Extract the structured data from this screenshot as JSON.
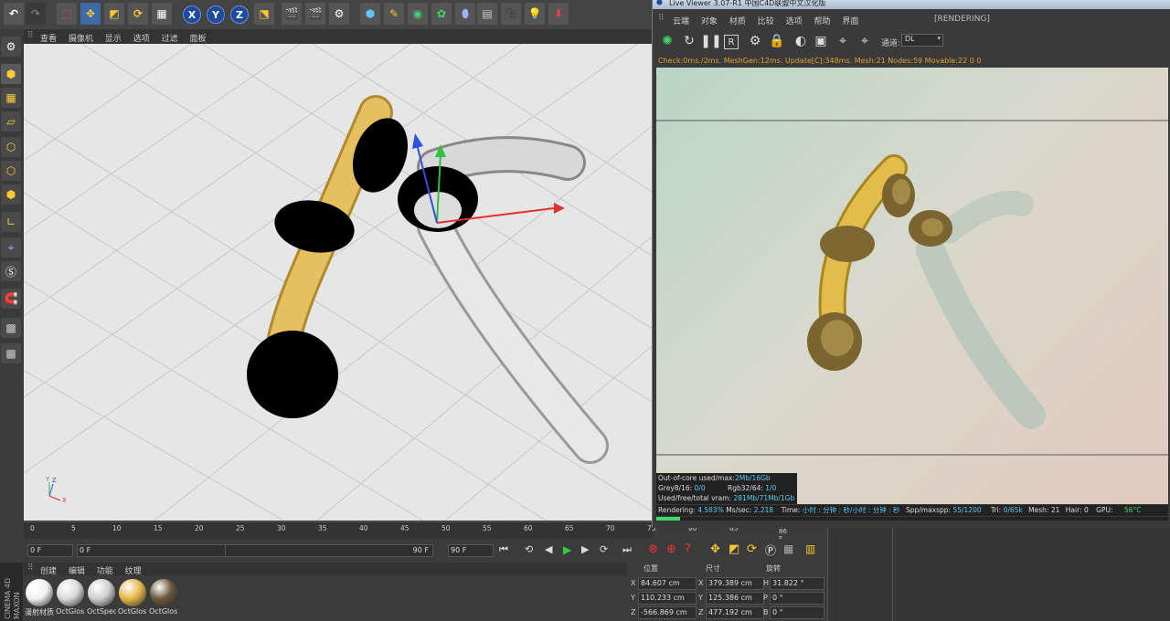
{
  "toolbar": {
    "axis_x": "X",
    "axis_y": "Y",
    "axis_z": "Z"
  },
  "viewport": {
    "menu": [
      "查看",
      "摄像机",
      "显示",
      "选项",
      "过滤",
      "面板"
    ],
    "gizmo_labels": {
      "y": "Y",
      "z": "Z",
      "x": "X"
    }
  },
  "timeline": {
    "ticks": [
      "0",
      "5",
      "10",
      "15",
      "20",
      "25",
      "30",
      "35",
      "40",
      "45",
      "50",
      "55",
      "60",
      "65",
      "70",
      "75",
      "80",
      "85"
    ],
    "current_frame": "0 F",
    "range_start": "0 F",
    "range_end": "90 F",
    "max_frame": "90 F",
    "marker": "86 F"
  },
  "material_manager": {
    "menu": [
      "创建",
      "编辑",
      "功能",
      "纹理"
    ],
    "materials": [
      {
        "label": "漫射材质",
        "color": "#f2f2f2"
      },
      {
        "label": "OctGlos",
        "color": "#d9d9d9"
      },
      {
        "label": "OctSpec",
        "color": "#cfcfcf"
      },
      {
        "label": "OctGlos",
        "color": "#e6b84a"
      },
      {
        "label": "OctGlos",
        "color": "#6b5a3a"
      }
    ],
    "brand": "CINEMA 4D",
    "brand2": "MAXON"
  },
  "coordinates": {
    "headers": [
      "位置",
      "尺寸",
      "旋转"
    ],
    "rows": [
      {
        "axis": "X",
        "pos": "84.607 cm",
        "size_axis": "X",
        "size": "379.389 cm",
        "rot_axis": "H",
        "rot": "31.822 °"
      },
      {
        "axis": "Y",
        "pos": "110.233 cm",
        "size_axis": "Y",
        "size": "125.386 cm",
        "rot_axis": "P",
        "rot": "0 °"
      },
      {
        "axis": "Z",
        "pos": "-566.869 cm",
        "size_axis": "Z",
        "size": "477.192 cm",
        "rot_axis": "B",
        "rot": "0 °"
      }
    ]
  },
  "live_viewer": {
    "title": "Live Viewer 3.07-R1  中国C4D联盟中文汉化版",
    "menu": [
      "云端",
      "对象",
      "材质",
      "比较",
      "选项",
      "帮助",
      "界面"
    ],
    "status_tag": "[RENDERING]",
    "channel_label": "通道:",
    "channel_value": "DL",
    "check_line": "Check:0ms./2ms. MeshGen:12ms. Update[C]:348ms. Mesh:21 Nodes:59 Movable:22  0 0",
    "stats": {
      "ooc_label": "Out-of-core used/max:",
      "ooc_value": "2Mb/16Gb",
      "grey_label": "Grey8/16:",
      "grey_value": "0/0",
      "rgb_label": "Rgb32/64:",
      "rgb_value": "1/0",
      "vram_label": "Used/free/total vram:",
      "vram_value": "281Mb/71Mb/1Gb"
    },
    "render_status": {
      "rendering_label": "Rendering:",
      "rendering_value": "4.583%",
      "mssec_label": "Ms/sec:",
      "mssec_value": "2.218",
      "time_label": "Time:",
      "time_value": "小时 : 分钟 : 秒/小时 : 分钟 : 秒",
      "spp_label": "Spp/maxspp:",
      "spp_value": "55/1200",
      "tri_label": "Tri:",
      "tri_value": "0/65k",
      "mesh_label": "Mesh:",
      "mesh_value": "21",
      "hair_label": "Hair:",
      "hair_value": "0",
      "gpu_label": "GPU:",
      "gpu_value": "56°C",
      "progress": 0.046
    }
  }
}
